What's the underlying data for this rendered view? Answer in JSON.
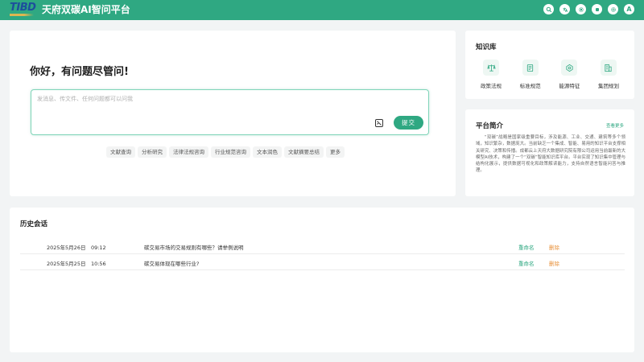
{
  "header": {
    "logo_text": "TIBD",
    "title": "天府双碳AI智问平台",
    "icons": [
      "search-icon",
      "translate-icon",
      "settings-icon",
      "record-icon",
      "gear-icon",
      "avatar-icon"
    ],
    "avatar_letter": "A"
  },
  "chat": {
    "greeting": "你好，有问题尽管问!",
    "placeholder": "发消息、传文件、任何问题都可以问我",
    "submit_label": "提交",
    "quick_tags": [
      "文献查询",
      "分析研究",
      "法律法规咨询",
      "行业规范咨询",
      "文本润色",
      "文献摘要总结",
      "更多"
    ]
  },
  "knowledge_base": {
    "title": "知识库",
    "items": [
      {
        "label": "政策法规",
        "icon": "scale-icon"
      },
      {
        "label": "标准规范",
        "icon": "document-icon"
      },
      {
        "label": "能源特征",
        "icon": "energy-icon"
      },
      {
        "label": "集团规划",
        "icon": "building-icon"
      }
    ]
  },
  "intro": {
    "title": "平台简介",
    "more_label": "查看更多",
    "text": "“双碳”战略是国家级重要目标，涉及能源、工业、交通、建筑等多个领域，知识繁杂，数据庞大。当前缺乏一个集成、智能、易用的知识平台支撑相关研究、决策和传播。成都云上天府大数据研究院有限公司运用当前最新的大模型AI技术，构建了一个“双碳”智能知识库平台。平台实现了知识集中管理与结构化展示，提供数据可视化和政策解读能力，支持自然语言智能问答与推理。"
  },
  "history": {
    "title": "历史会话",
    "rows": [
      {
        "date": "2025年5月26日　09:12",
        "title": "碳交易市场的交易规则有哪些？请举例说明",
        "rename": "重命名",
        "delete": "删除"
      },
      {
        "date": "2025年5月25日　10:56",
        "title": "碳交易体现在哪些行业?",
        "rename": "重命名",
        "delete": "删除"
      }
    ]
  },
  "colors": {
    "accent": "#2fa882",
    "delete": "#e8913a",
    "background": "#f2f4f5"
  }
}
